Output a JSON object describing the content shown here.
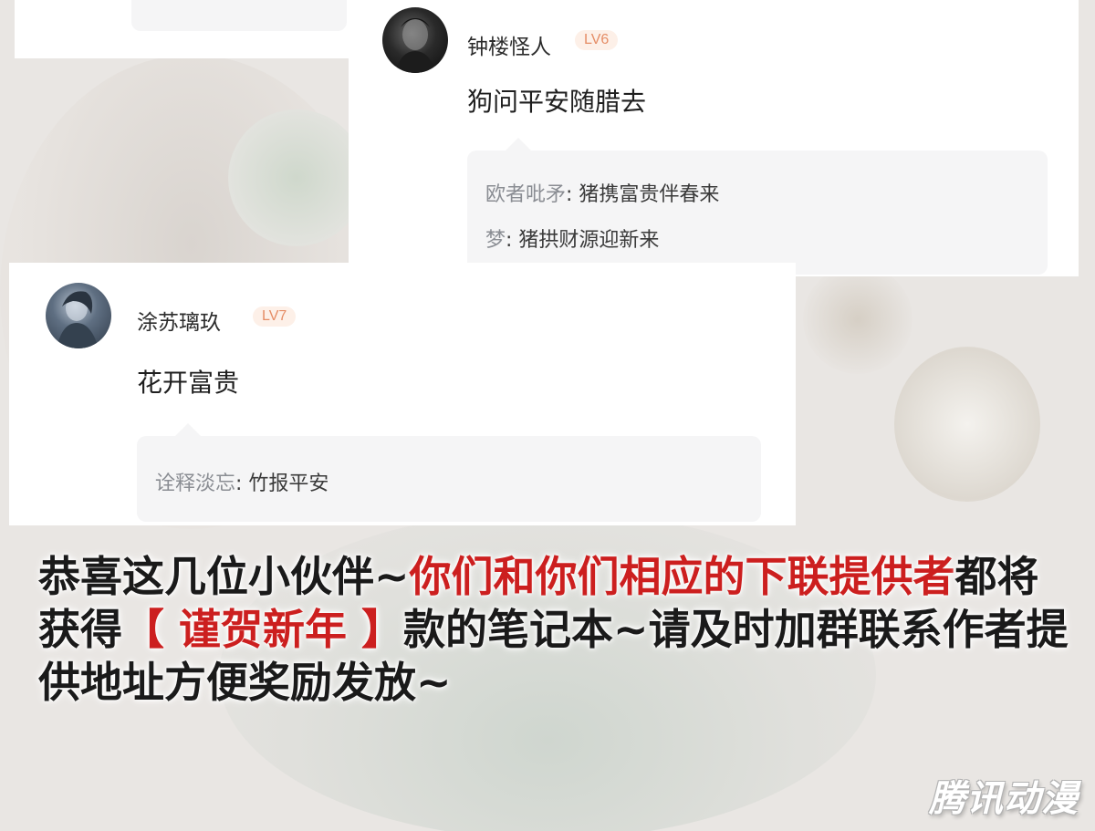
{
  "comments": [
    {
      "username": "钟楼怪人",
      "level": "LV6",
      "text": "狗问平安随腊去",
      "replies": [
        {
          "name": "欧者吡矛",
          "text": ": 猪携富贵伴春来"
        },
        {
          "name": "梦",
          "text": ": 猪拱财源迎新来"
        }
      ]
    },
    {
      "username": "涂苏璃玖",
      "level": "LV7",
      "text": "花开富贵",
      "replies": [
        {
          "name": "诠释淡忘",
          "text": ": 竹报平安"
        }
      ]
    }
  ],
  "announcement": {
    "part1": "恭喜这几位小伙伴~",
    "part2": "你们和你们相应的下联提供者",
    "part3": "都将获得",
    "part4": "【 谨贺新年 】",
    "part5": "款的笔记本~请及时加群联系作者提供地址方便奖励发放~"
  },
  "watermark": "腾讯动漫",
  "colors": {
    "highlight": "#cc1f1f",
    "level_text": "#e58d66",
    "reply_name": "#8a8d93"
  }
}
